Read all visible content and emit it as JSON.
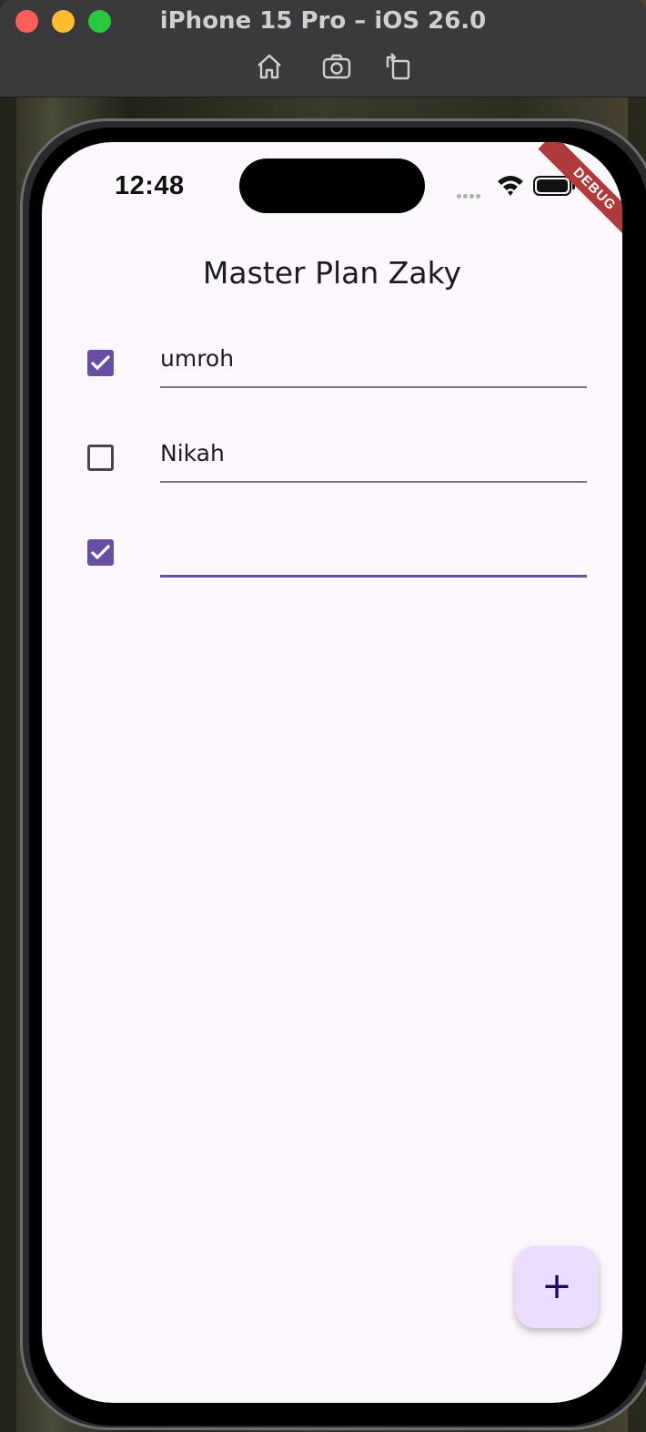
{
  "window": {
    "title": "iPhone 15 Pro – iOS 26.0",
    "toolbar": [
      "home-icon",
      "screenshot-icon",
      "rotate-icon"
    ]
  },
  "status_bar": {
    "time": "12:48"
  },
  "debug_banner": "DEBUG",
  "app": {
    "title": "Master Plan Zaky",
    "tasks": [
      {
        "checked": true,
        "text": "umroh",
        "placeholder": ""
      },
      {
        "checked": false,
        "text": "Nikah",
        "placeholder": ""
      },
      {
        "checked": true,
        "text": "",
        "placeholder": "",
        "focused": true
      }
    ],
    "fab_label": "+"
  },
  "colors": {
    "primary": "#6750a4",
    "surface": "#fcf7fc",
    "fab_container": "#eaddff"
  }
}
